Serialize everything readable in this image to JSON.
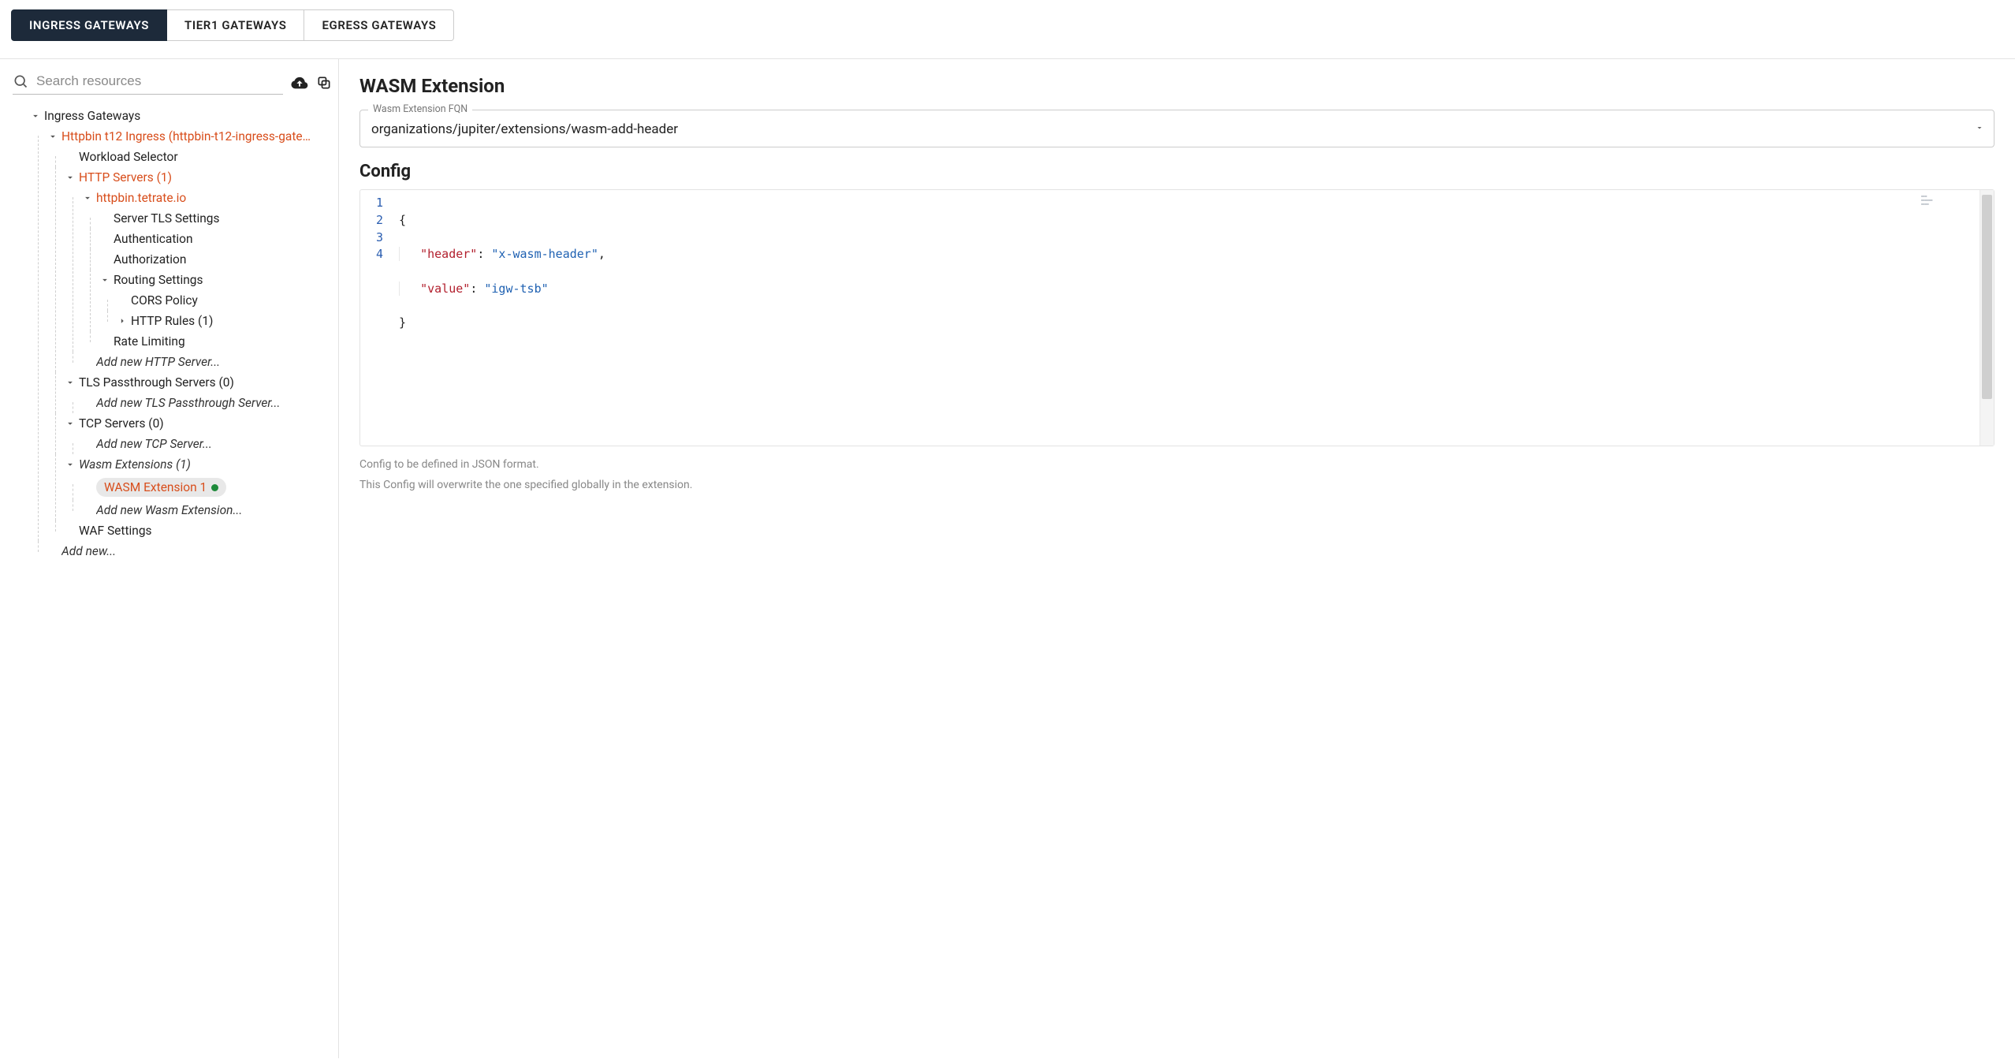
{
  "tabs": {
    "ingress": "INGRESS GATEWAYS",
    "tier1": "TIER1 GATEWAYS",
    "egress": "EGRESS GATEWAYS"
  },
  "sidebar": {
    "search_placeholder": "Search resources",
    "root": "Ingress Gateways",
    "httpbin": "Httpbin t12 Ingress (httpbin-t12-ingress-gate…",
    "workload": "Workload Selector",
    "http_servers": "HTTP Servers (1)",
    "host": "httpbin.tetrate.io",
    "tls_settings": "Server TLS Settings",
    "authn": "Authentication",
    "authz": "Authorization",
    "routing": "Routing Settings",
    "cors": "CORS Policy",
    "http_rules": "HTTP Rules (1)",
    "rate": "Rate Limiting",
    "add_http": "Add new HTTP Server...",
    "tls_pass": "TLS Passthrough Servers (0)",
    "add_tls": "Add new TLS Passthrough Server...",
    "tcp": "TCP Servers (0)",
    "add_tcp": "Add new TCP Server...",
    "wasm_ext": "Wasm Extensions (1)",
    "wasm_ext_1": "WASM Extension 1",
    "add_wasm": "Add new Wasm Extension...",
    "waf": "WAF Settings",
    "add_new": "Add new..."
  },
  "main": {
    "title": "WASM Extension",
    "fqn_label": "Wasm Extension FQN",
    "fqn_value": "organizations/jupiter/extensions/wasm-add-header",
    "config_title": "Config",
    "editor": {
      "lines": [
        "1",
        "2",
        "3",
        "4"
      ],
      "k_header": "\"header\"",
      "v_header": "\"x-wasm-header\"",
      "k_value": "\"value\"",
      "v_value": "\"igw-tsb\""
    },
    "hint1": "Config to be defined in JSON format.",
    "hint2": "This Config will overwrite the one specified globally in the extension."
  }
}
